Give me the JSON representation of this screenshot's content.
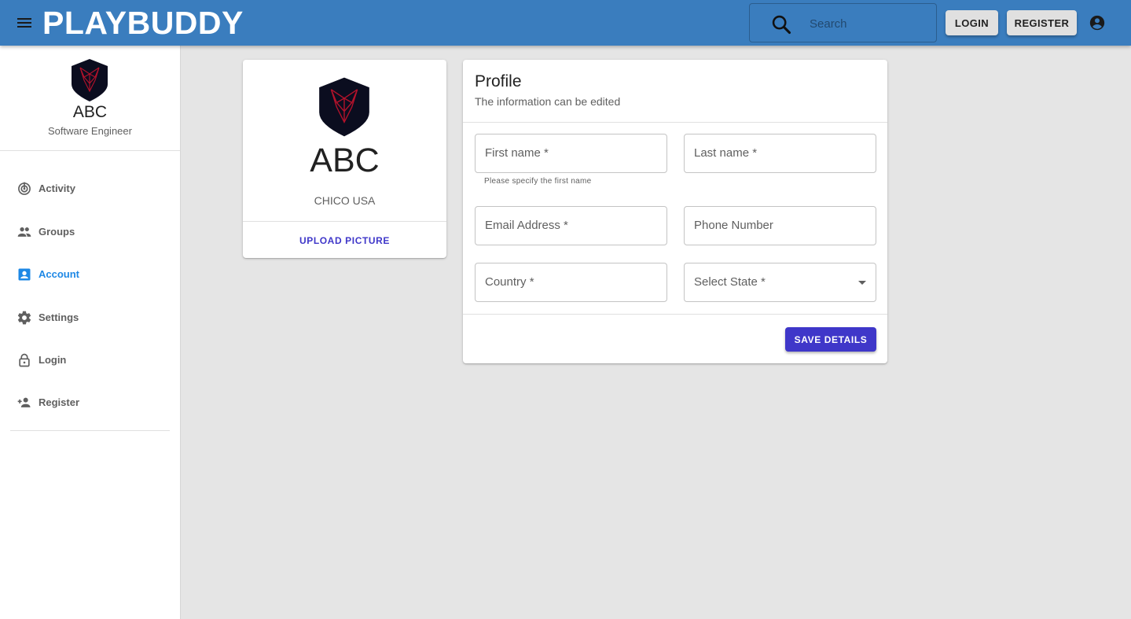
{
  "appbar": {
    "brand": "PLAYBUDDY",
    "search_placeholder": "Search",
    "login_label": "LOGIN",
    "register_label": "REGISTER",
    "background_color": "#3a7dbe"
  },
  "sidebar": {
    "name": "ABC",
    "title": "Software Engineer",
    "items": [
      {
        "label": "Activity",
        "icon": "activity-icon"
      },
      {
        "label": "Groups",
        "icon": "groups-icon"
      },
      {
        "label": "Account",
        "icon": "account-box-icon",
        "active": true
      },
      {
        "label": "Settings",
        "icon": "gear-icon"
      },
      {
        "label": "Login",
        "icon": "lock-icon"
      },
      {
        "label": "Register",
        "icon": "person-add-icon"
      }
    ],
    "active_color": "#1e88e5"
  },
  "profile_card": {
    "name": "ABC",
    "location": "CHICO USA",
    "upload_label": "UPLOAD PICTURE"
  },
  "profile_form": {
    "title": "Profile",
    "subtitle": "The information can be edited",
    "fields": {
      "first_name": "First name *",
      "first_name_helper": "Please specify the first name",
      "last_name": "Last name *",
      "email": "Email Address *",
      "phone": "Phone Number",
      "country": "Country *",
      "state": "Select State *"
    },
    "save_label": "SAVE DETAILS",
    "accent_color": "#3f37c9"
  }
}
